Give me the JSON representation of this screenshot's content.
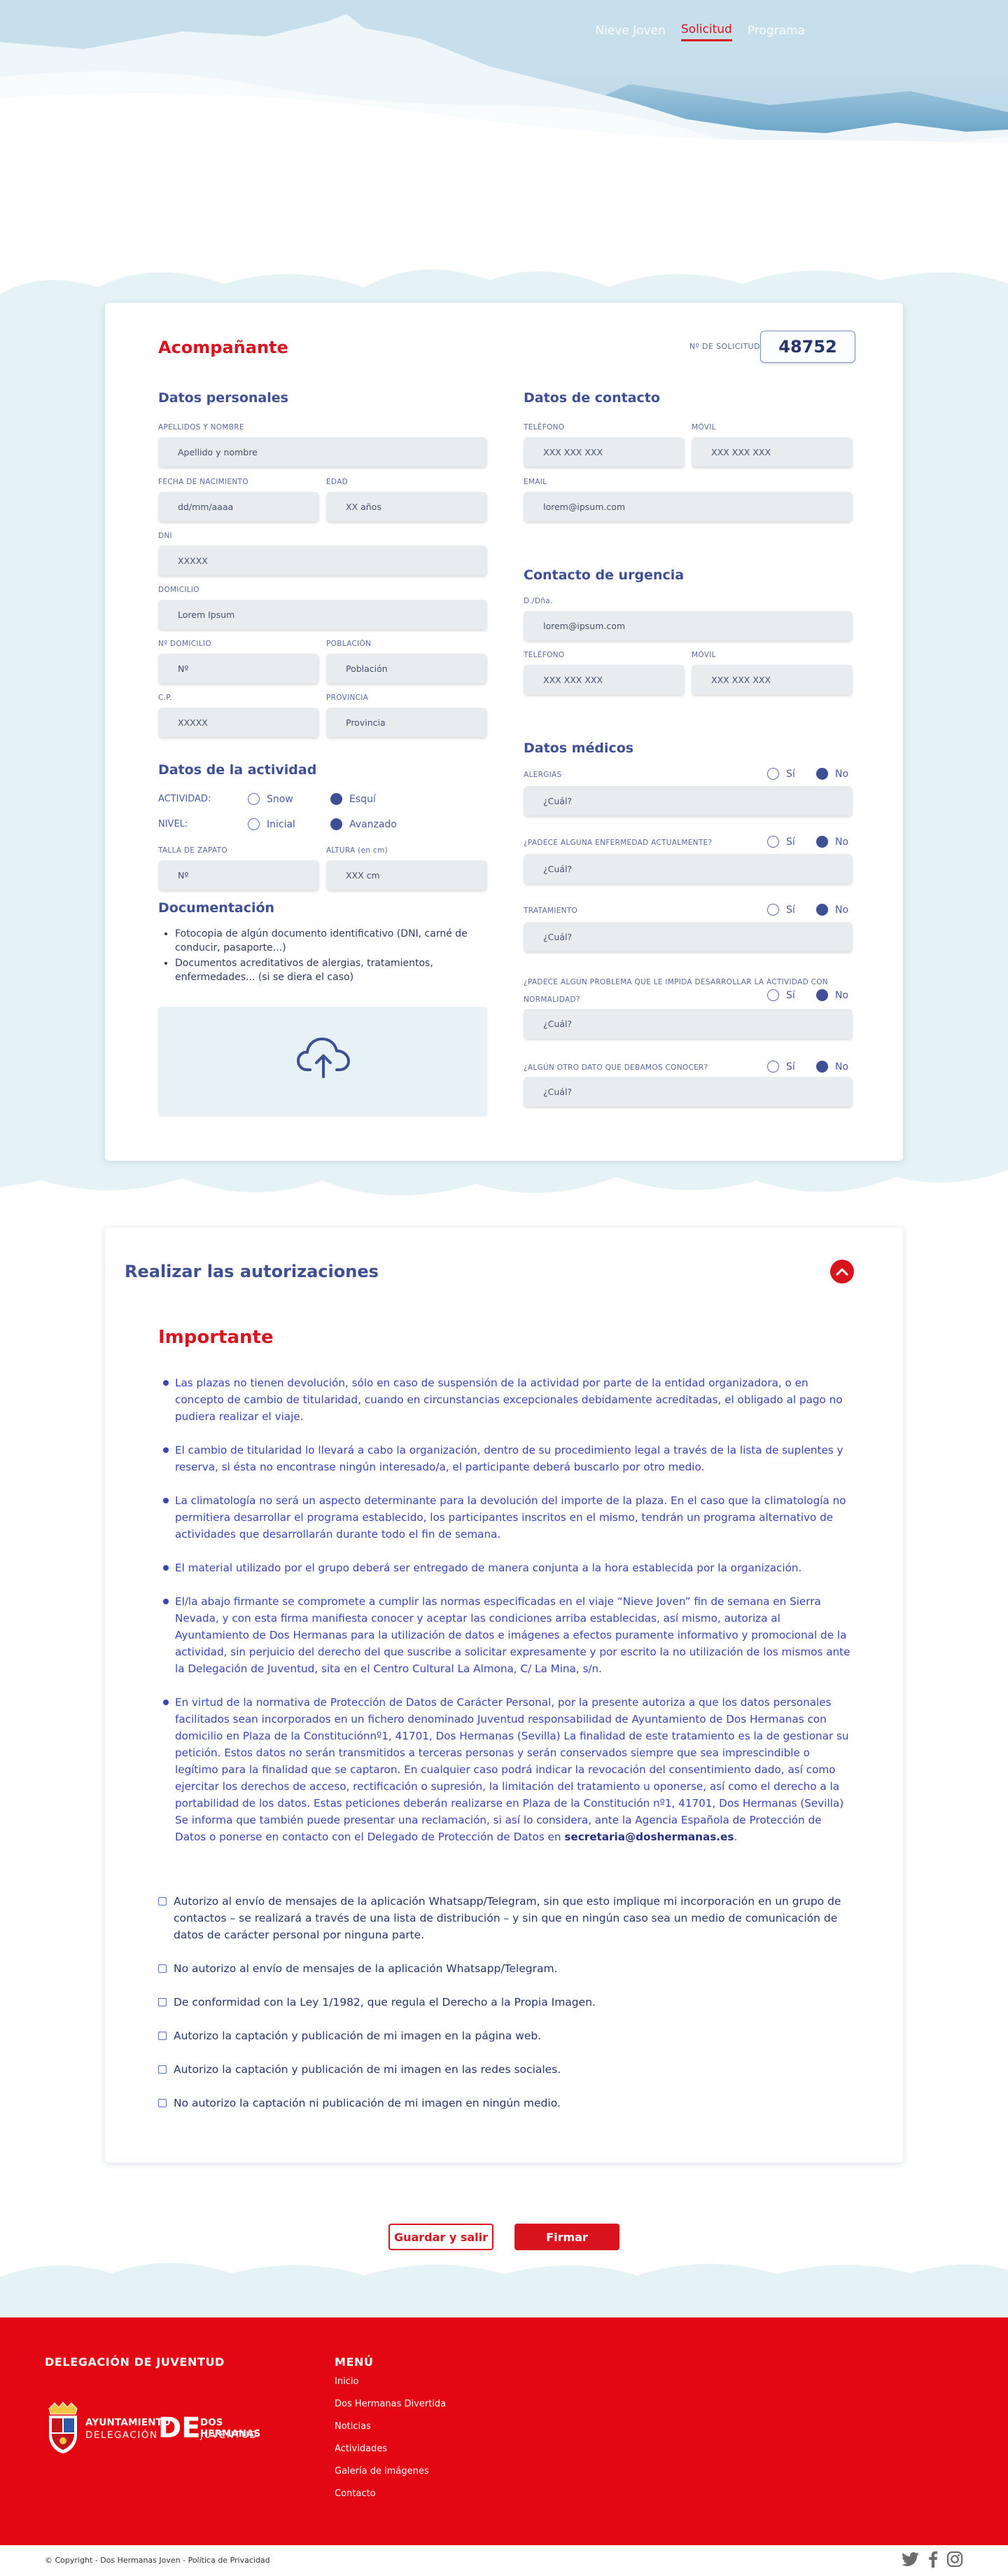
{
  "nav": {
    "items": [
      {
        "label": "Nieve Joven",
        "active": false
      },
      {
        "label": "Solicitud",
        "active": true
      },
      {
        "label": "Programa",
        "active": false
      }
    ]
  },
  "form": {
    "title": "Acompañante",
    "solicitud_label": "Nº DE SOLICITUD:",
    "solicitud_number": "48752",
    "personal": {
      "heading": "Datos personales",
      "nombre_label": "APELLIDOS Y NOMBRE",
      "nombre_placeholder": "Apellido y nombre",
      "fecha_label": "FECHA DE NACIMIENTO",
      "fecha_placeholder": "dd/mm/aaaa",
      "edad_label": "EDAD",
      "edad_placeholder": "XX años",
      "dni_label": "DNI",
      "dni_placeholder": "XXXXX",
      "domicilio_label": "DOMICILIO",
      "domicilio_placeholder": "Lorem Ipsum",
      "ndomicilio_label": "Nº DOMICILIO",
      "ndomicilio_placeholder": "Nº",
      "poblacion_label": "POBLACIÓN",
      "poblacion_placeholder": "Población",
      "cp_label": "C.P.",
      "cp_placeholder": "XXXXX",
      "provincia_label": "PROVINCIA",
      "provincia_placeholder": "Provincia"
    },
    "actividad": {
      "heading": "Datos de la actividad",
      "actividad_label": "ACTIVIDAD:",
      "actividad_options": [
        "Snow",
        "Esquí"
      ],
      "actividad_selected": "Esquí",
      "nivel_label": "NIVEL:",
      "nivel_options": [
        "Inicial",
        "Avanzado"
      ],
      "nivel_selected": "Avanzado",
      "talla_label": "TALLA DE ZAPATO",
      "talla_placeholder": "Nº",
      "altura_label": "ALTURA (en cm)",
      "altura_placeholder": "XXX cm"
    },
    "documentacion": {
      "heading": "Documentación",
      "items": [
        "Fotocopia de algún documento identificativo (DNI, carné de conducir, pasaporte...)",
        "Documentos acreditativos de alergias, tratamientos, enfermedades... (si se diera el caso)"
      ],
      "upload_icon": "cloud-upload-icon"
    },
    "contacto": {
      "heading": "Datos de contacto",
      "telefono_label": "TELÉFONO",
      "telefono_placeholder": "XXX XXX XXX",
      "movil_label": "MÓVIL",
      "movil_placeholder": "XXX XXX XXX",
      "email_label": "EMAIL",
      "email_placeholder": "lorem@ipsum.com"
    },
    "urgencia": {
      "heading": "Contacto de urgencia",
      "dona_label": "D./Dña.",
      "dona_placeholder": "lorem@ipsum.com",
      "telefono_label": "TELÉFONO",
      "telefono_placeholder": "XXX XXX XXX",
      "movil_label": "MÓVIL",
      "movil_placeholder": "XXX XXX XXX"
    },
    "medicos": {
      "heading": "Datos médicos",
      "yes": "Sí",
      "no": "No",
      "questions": [
        {
          "label": "ALERGIAS",
          "placeholder": "¿Cuál?",
          "selected": "No"
        },
        {
          "label": "¿PADECE ALGUNA ENFERMEDAD ACTUALMENTE?",
          "placeholder": "¿Cuál?",
          "selected": "No"
        },
        {
          "label": "TRATAMIENTO",
          "placeholder": "¿Cuál?",
          "selected": "No"
        },
        {
          "label": "¿PADECE ALGÚN PROBLEMA QUE LE IMPIDA DESARROLLAR LA ACTIVIDAD CON NORMALIDAD?",
          "placeholder": "¿Cuál?",
          "selected": "No"
        },
        {
          "label": "¿ALGÚN OTRO DATO QUE DEBAMOS CONOCER?",
          "placeholder": "¿Cuál?",
          "selected": "No"
        }
      ]
    }
  },
  "autorizaciones": {
    "title": "Realizar las autorizaciones",
    "toggle_icon": "chevron-up-icon",
    "importante": "Importante",
    "bullets": [
      "Las plazas no tienen devolución, sólo en caso de suspensión de la actividad por parte de la entidad organizadora, o en concepto de cambio de titularidad, cuando en circunstancias excepcionales debidamente acreditadas, el obligado al pago no pudiera realizar el viaje.",
      "El cambio de titularidad lo llevará a cabo la organización, dentro de su procedimiento legal a través de la lista de suplentes y reserva, si ésta no encontrase ningún interesado/a, el participante deberá buscarlo por otro medio.",
      "La climatología no será un aspecto determinante para la devolución del importe de la plaza. En el caso que la climatología no permitiera desarrollar el programa establecido, los participantes inscritos en el mismo, tendrán un programa alternativo de actividades que desarrollarán durante todo el fin de semana.",
      "El material utilizado por el grupo deberá ser entregado de manera conjunta a la hora establecida por la organización.",
      "El/la abajo firmante se compromete a cumplir las normas especificadas en el viaje “Nieve Joven” fin de semana en Sierra Nevada, y con esta firma manifiesta conocer y aceptar las condiciones arriba establecidas, así mismo, autoriza al Ayuntamiento de Dos Hermanas para la utilización de datos e imágenes a efectos puramente informativo y promocional de la actividad, sin perjuicio del derecho del que suscribe a solicitar expresamente y por escrito la no utilización de los mismos ante la Delegación de Juventud, sita en el Centro Cultural La Almona, C/ La Mina, s/n."
    ],
    "lopd_text": "En virtud de la  normativa de  Protección de Datos de Carácter Personal, por la presente autoriza a que los datos personales facilitados sean  incorporados en un fichero denominado Juventud  responsabilidad de Ayuntamiento de Dos Hermanas con domicilio en Plaza de la Constituciónnº1, 41701, Dos Hermanas (Sevilla) La finalidad de este tratamiento  es la de gestionar su petición. Estos datos  no serán transmitidos  a terceras personas y serán conservados siempre que sea imprescindible o legítimo para la finalidad que se captaron.  En cualquier caso podrá indicar la revocación del consentimiento dado, así como ejercitar los derechos de acceso, rectificación o supresión, la limitación del tratamiento u oponerse, así  como el derecho a la portabilidad de los datos. Estas peticiones deberán realizarse en Plaza de la Constitución nº1, 41701, Dos Hermanas (Sevilla) Se informa que también puede presentar una reclamación, si así lo considera, ante la Agencia Española de Protección de Datos o ponerse en contacto con el Delegado de Protección de Datos en ",
    "lopd_email": "secretaria@doshermanas.es",
    "lopd_end": ".",
    "checkboxes": [
      "Autorizo al envío de mensajes de la aplicación Whatsapp/Telegram, sin que esto implique mi incorporación en un grupo de contactos – se realizará a través de una lista de distribución – y sin que en ningún caso sea un medio de comunicación de datos de carácter personal por ninguna parte.",
      "No autorizo al envío de mensajes de la aplicación Whatsapp/Telegram.",
      "De conformidad con la Ley 1/1982, que regula el Derecho a la Propia Imagen.",
      "Autorizo la captación y publicación de mi imagen en la página web.",
      "Autorizo la captación y publicación de mi imagen en las redes sociales.",
      "No autorizo la captación ni publicación de mi imagen en ningún medio."
    ]
  },
  "actions": {
    "save": "Guardar y salir",
    "sign": "Firmar"
  },
  "footer": {
    "delegacion": "DELEGACIÓN DE JUVENTUD",
    "menu_title": "MENÚ",
    "menu": [
      "Inicio",
      "Dos Hermanas Divertida",
      "Noticias",
      "Actividades",
      "Galería de imágenes",
      "Contacto"
    ],
    "logo": {
      "line1": "AYUNTAMIENTO",
      "line2": "DELEGACIÓN",
      "de": "DE",
      "line3": "DOS HERMANAS",
      "line4": "JUVENTUD"
    },
    "copyright": "© Copyright - Dos Hermanas Joven - Política de Privacidad",
    "social": [
      "twitter-icon",
      "facebook-icon",
      "instagram-icon"
    ]
  },
  "colors": {
    "accent": "#d9141f",
    "primary": "#3f4f96",
    "sky": "#a9cfe2",
    "snow_band": "#e6f4f8",
    "footer": "#e30613"
  }
}
